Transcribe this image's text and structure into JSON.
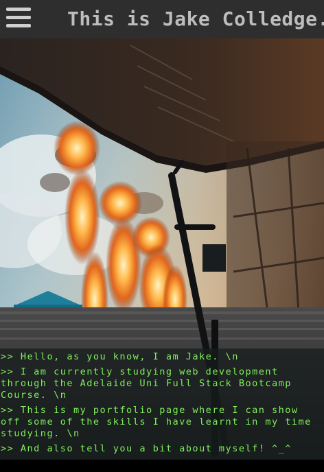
{
  "header": {
    "title": "This is Jake Colledge.",
    "menu_icon": "hamburger-menu-icon"
  },
  "hero": {
    "image": "concert-stage-pyrotechnics-photo"
  },
  "terminal": {
    "lines": [
      ">> Hello, as you know, I am Jake. \\n",
      ">> I am currently studying web development through the Adelaide Uni Full Stack Bootcamp Course. \\n",
      ">> This is my portfolio page where I can show off some of the skills I have learnt in my time studying. \\n",
      ">> And also tell you a bit about myself! ^_^"
    ]
  },
  "colors": {
    "header_bg": "#2e2e2e",
    "title_text": "#bdbdbd",
    "terminal_text": "#7ff05a"
  }
}
